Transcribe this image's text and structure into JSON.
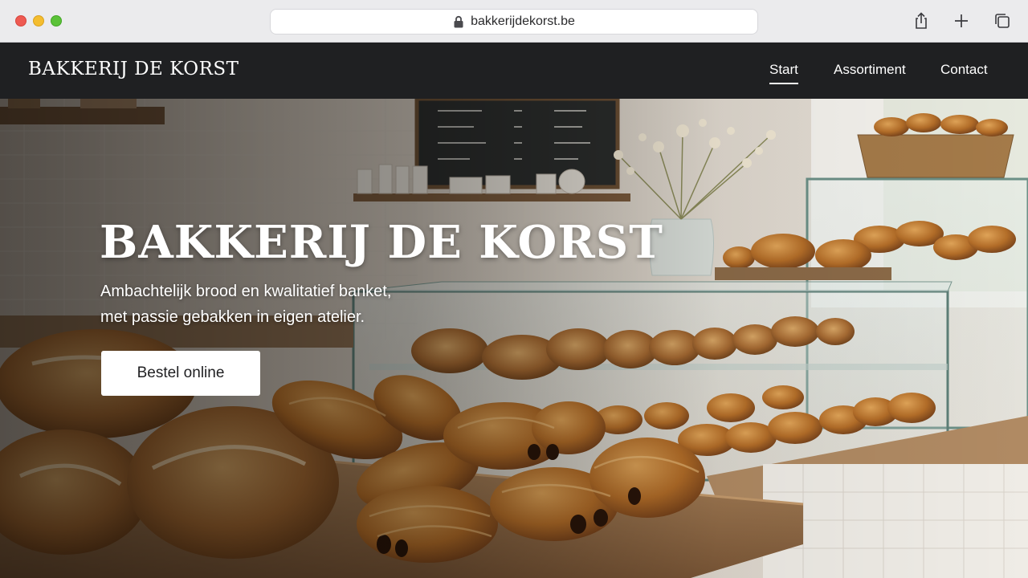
{
  "browser": {
    "url": "bakkerijdekorst.be"
  },
  "nav": {
    "brand": "BAKKERIJ DE KORST",
    "links": [
      {
        "label": "Start",
        "active": true
      },
      {
        "label": "Assortiment",
        "active": false
      },
      {
        "label": "Contact",
        "active": false
      }
    ]
  },
  "hero": {
    "title": "BAKKERIJ DE KORST",
    "subtitle_lines": [
      "Ambachtelijk brood en kwalitatief banket,",
      "met passie gebakken in eigen atelier."
    ],
    "cta_label": "Bestel online"
  },
  "colors": {
    "nav_bg": "#1f2022",
    "chrome_bg": "#ebebed",
    "cta_bg": "#ffffff",
    "text_light": "#ffffff"
  },
  "icons": [
    "lock-icon",
    "share-icon",
    "plus-icon",
    "tabs-icon"
  ]
}
